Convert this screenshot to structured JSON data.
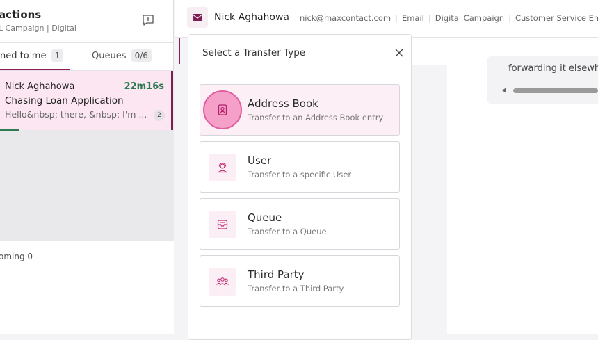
{
  "left_panel": {
    "title": "actions",
    "subtitle": "L Campaign | Digital",
    "tabs": {
      "mine_label": "ned to me",
      "mine_count": "1",
      "queues_label": "Queues",
      "queues_count": "0/6"
    },
    "conversation": {
      "name": "Nick Aghahowa",
      "time": "22m16s",
      "subject": "Chasing Loan Application",
      "preview": "Hello&nbsp; there, &nbsp; I'm ...",
      "badge": "2"
    },
    "upcoming": "oming 0"
  },
  "header": {
    "contact_name": "Nick Aghahowa",
    "email": "nick@maxcontact.com",
    "channel": "Email",
    "campaign": "Digital Campaign",
    "queue": "Customer Service Email"
  },
  "message": {
    "text": "forwarding it elsewh"
  },
  "modal": {
    "title": "Select a Transfer Type",
    "options": [
      {
        "title": "Address Book",
        "description": "Transfer to an Address Book entry"
      },
      {
        "title": "User",
        "description": "Transfer to a specific User"
      },
      {
        "title": "Queue",
        "description": "Transfer to a Queue"
      },
      {
        "title": "Third Party",
        "description": "Transfer to a Third Party"
      }
    ]
  },
  "colors": {
    "accent": "#8b1d5c",
    "icon_pink": "#c2307a",
    "timer_green": "#2e7a52",
    "selected_bg": "#fdeff6"
  }
}
